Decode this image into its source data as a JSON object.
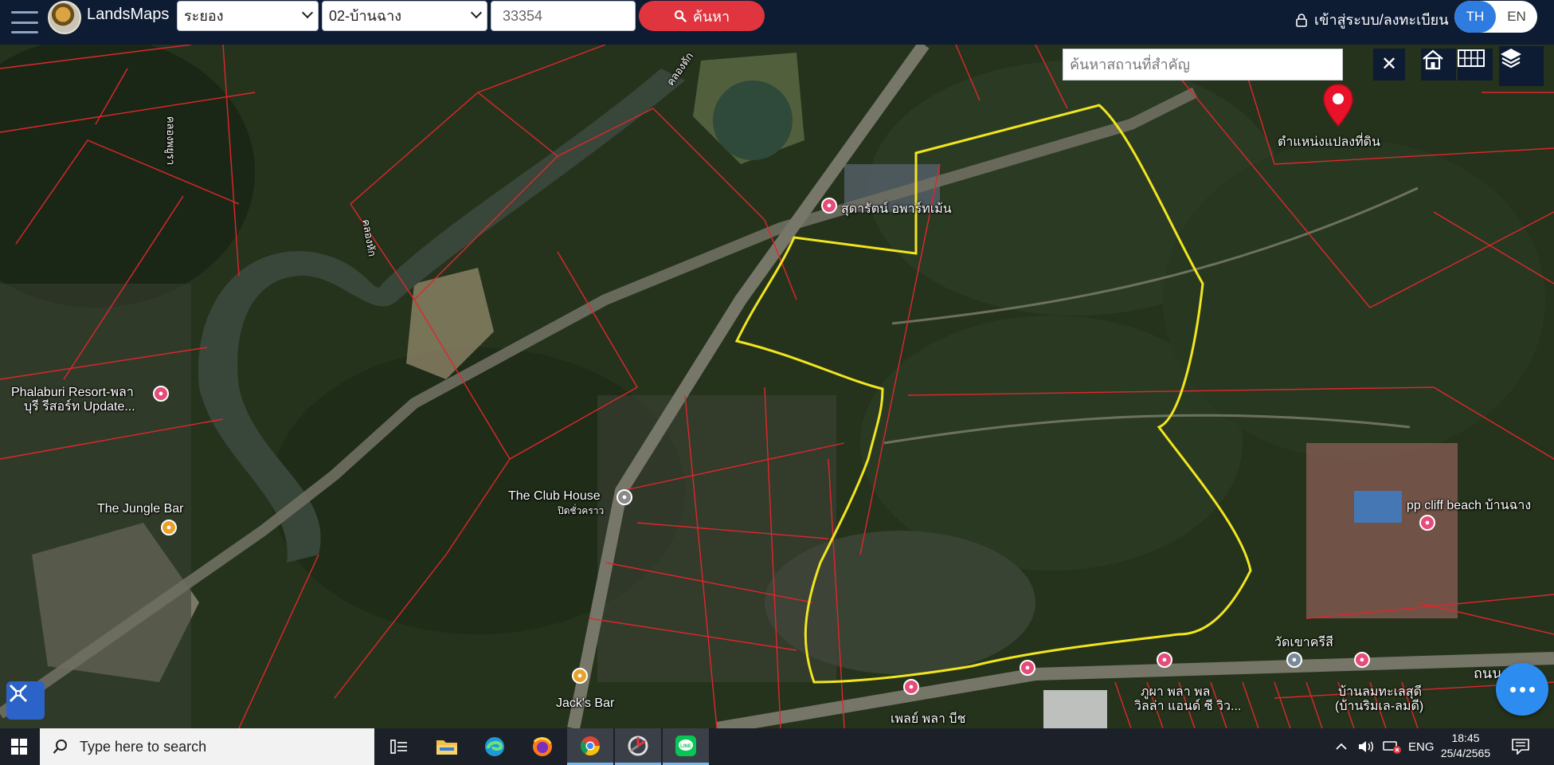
{
  "header": {
    "brand": "LandsMaps",
    "province": "ระยอง",
    "district": "02-บ้านฉาง",
    "parcel_number": "33354",
    "search_label": "ค้นหา",
    "login_label": "เข้าสู่ระบบ/ลงทะเบียน",
    "lang_th": "TH",
    "lang_en": "EN"
  },
  "map": {
    "place_search_placeholder": "ค้นหาสถานที่สำคัญ",
    "parcel_marker_label": "ตำแหน่งแปลงที่ดิน",
    "labels": {
      "canal_1": "คลองหัก",
      "canal_2": "คลองพยูรา",
      "canal_3": "คลองตัก",
      "apartment": "สุดารัตน์ อพาร์ทเม้น",
      "resort_1": "Phalaburi Resort-พลา",
      "resort_2": "บุรี รีสอร์ท Update...",
      "jungle_bar": "The Jungle Bar",
      "club_house": "The Club House",
      "club_house_sub": "ปิดชั่วคราว",
      "cliff_beach": "pp cliff beach บ้านฉาง",
      "temple": "วัดเขาครีสี",
      "road": "ถนน พลา",
      "villa_1": "ภูผา พลา พล",
      "villa_2": "วิลล่า แอนด์ ซี วิว...",
      "baan_1": "บ้านลมทะเลสุดี",
      "baan_2": "(บ้านริมเล-ลมดี)",
      "play_beach": "เพลย์ พลา บีช",
      "jacks_bar": "Jack's Bar"
    }
  },
  "taskbar": {
    "search_placeholder": "Type here to search",
    "lang_indicator": "ENG",
    "time": "18:45",
    "date": "25/4/2565"
  },
  "colors": {
    "header_bg": "#0d1b33",
    "search_button": "#e0343f",
    "lang_active": "#2f7ce0",
    "parcel_outline": "#e0262c",
    "highlight_outline": "#f2e520",
    "marker": "#e8122a"
  }
}
